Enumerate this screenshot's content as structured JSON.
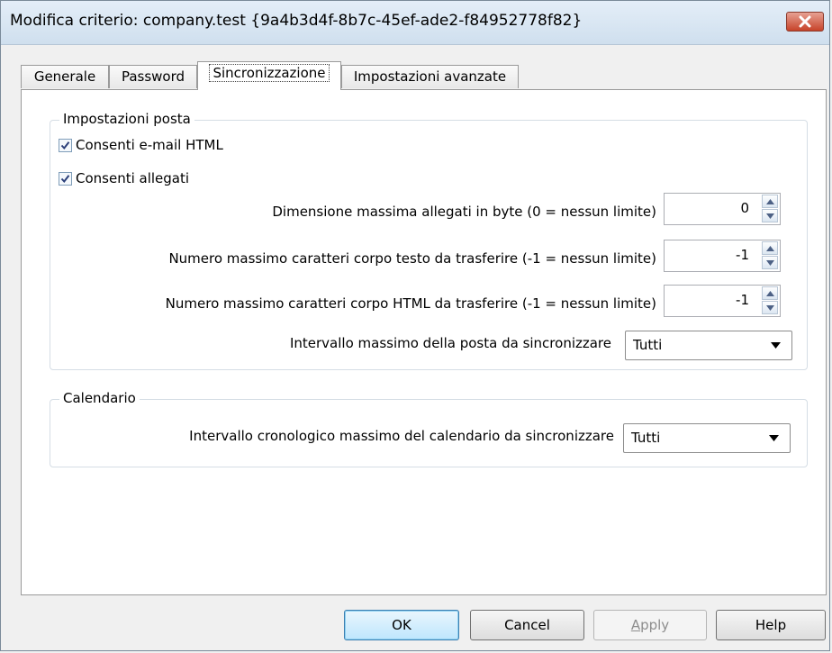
{
  "window": {
    "title": "Modifica criterio:  company.test {9a4b3d4f-8b7c-45ef-ade2-f84952778f82}"
  },
  "tabs": [
    {
      "label": "Generale"
    },
    {
      "label": "Password"
    },
    {
      "label": "Sincronizzazione",
      "active": true
    },
    {
      "label": "Impostazioni avanzate"
    }
  ],
  "mail": {
    "group_title": "Impostazioni posta",
    "allow_html_label": "Consenti e-mail HTML",
    "allow_html_checked": true,
    "allow_attachments_label": "Consenti allegati",
    "allow_attachments_checked": true,
    "max_attachment_label": "Dimensione massima allegati in byte (0 = nessun limite)",
    "max_attachment_value": "0",
    "max_text_label": "Numero massimo caratteri corpo testo da trasferire (-1 = nessun limite)",
    "max_text_value": "-1",
    "max_html_label": "Numero massimo caratteri corpo HTML da trasferire (-1 = nessun limite)",
    "max_html_value": "-1",
    "mail_interval_label": "Intervallo massimo della posta da sincronizzare",
    "mail_interval_value": "Tutti"
  },
  "calendar": {
    "group_title": "Calendario",
    "interval_label": "Intervallo cronologico massimo del calendario da sincronizzare",
    "interval_value": "Tutti"
  },
  "buttons": {
    "ok": "OK",
    "cancel": "Cancel",
    "apply_mnemonic": "A",
    "apply_rest": "pply",
    "help": "Help"
  }
}
